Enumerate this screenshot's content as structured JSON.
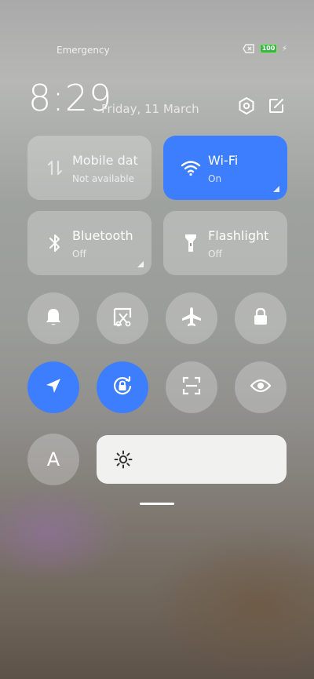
{
  "status_bar": {
    "carrier": "Emergency",
    "battery_level": "100",
    "icons": [
      "no-sim-icon",
      "battery-icon",
      "charging-icon"
    ]
  },
  "header": {
    "time": "8:29",
    "date": "Friday, 11 March",
    "buttons": [
      "settings-icon",
      "edit-icon"
    ]
  },
  "tiles": [
    {
      "title": "Mobile dat",
      "subtitle": "Not available",
      "icon": "mobile-data-icon",
      "active": false
    },
    {
      "title": "Wi-Fi",
      "subtitle": "On",
      "icon": "wifi-icon",
      "active": true
    },
    {
      "title": "Bluetooth",
      "subtitle": "Off",
      "icon": "bluetooth-icon",
      "active": false
    },
    {
      "title": "Flashlight",
      "subtitle": "Off",
      "icon": "flashlight-icon",
      "active": false
    }
  ],
  "toggles": [
    {
      "icon": "bell-icon",
      "active": false
    },
    {
      "icon": "screenshot-icon",
      "active": false
    },
    {
      "icon": "airplane-icon",
      "active": false
    },
    {
      "icon": "lock-icon",
      "active": false
    },
    {
      "icon": "location-icon",
      "active": true
    },
    {
      "icon": "rotation-lock-icon",
      "active": true
    },
    {
      "icon": "scanner-icon",
      "active": false
    },
    {
      "icon": "eye-icon",
      "active": false
    }
  ],
  "font_button_label": "A",
  "brightness": {
    "icon": "sun-icon",
    "level": 0.0
  },
  "colors": {
    "accent": "#3d7eff",
    "tile_bg": "rgba(255,255,255,0.25)",
    "slider_bg": "#f1f1ef"
  }
}
